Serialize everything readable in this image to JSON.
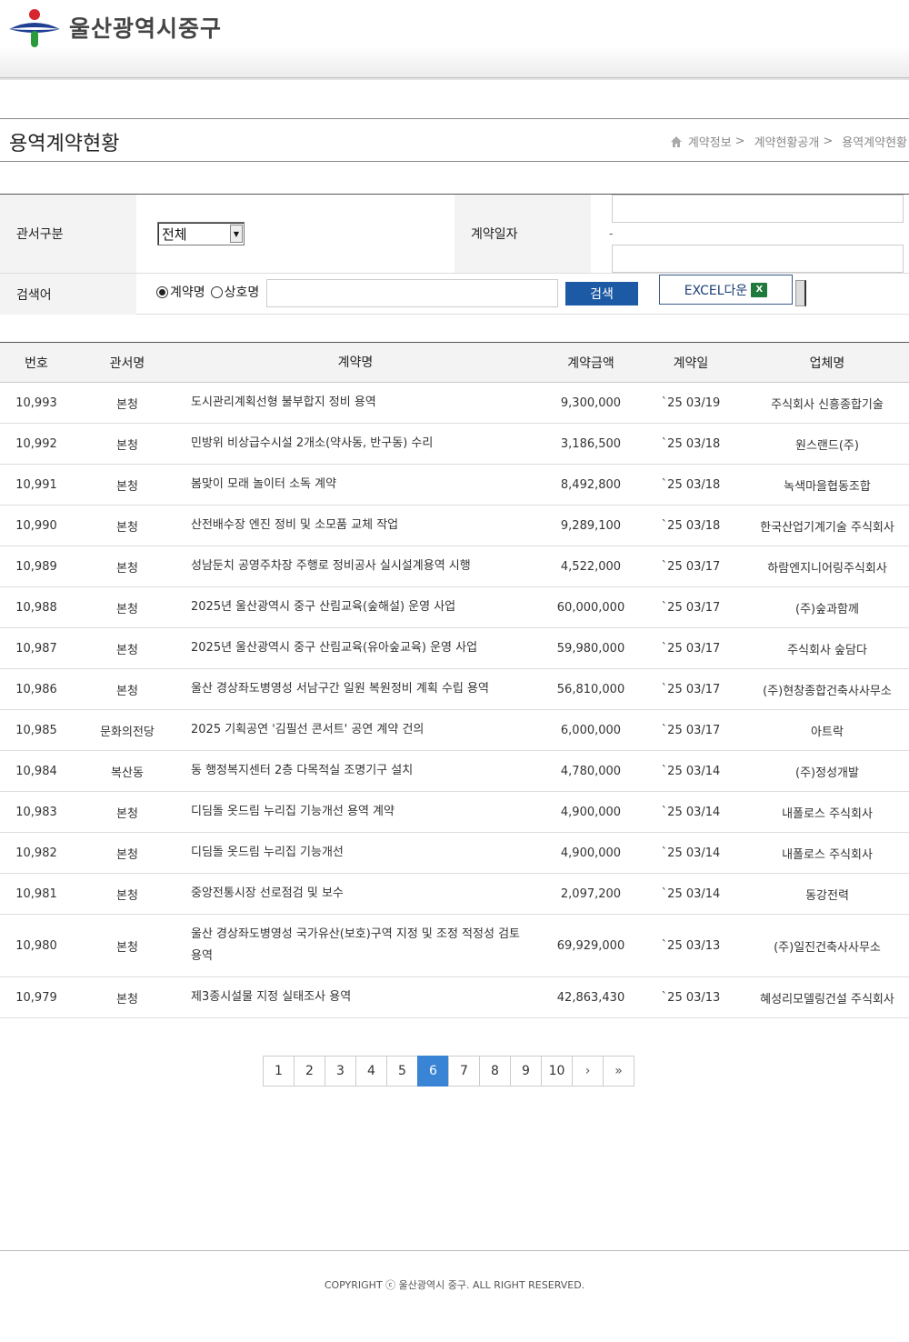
{
  "header": {
    "org_name": "울산광역시중구"
  },
  "page": {
    "title": "용역계약현황",
    "breadcrumb": [
      "계약정보",
      "계약현황공개",
      "용역계약현황"
    ],
    "breadcrumb_sep": ">"
  },
  "search": {
    "dept_label": "관서구분",
    "dept_value": "전체",
    "date_label": "계약일자",
    "date_sep": "-",
    "keyword_label": "검색어",
    "radio_contract": "계약명",
    "radio_company": "상호명",
    "search_button": "검색",
    "excel_button": "EXCEL다운",
    "excel_icon_text": "X"
  },
  "table": {
    "headers": [
      "번호",
      "관서명",
      "계약명",
      "계약금액",
      "계약일",
      "업체명"
    ],
    "rows": [
      [
        "10,993",
        "본청",
        "도시관리계획선형 불부합지 정비 용역",
        "9,300,000",
        "`25 03/19",
        "주식회사 신흥종합기술"
      ],
      [
        "10,992",
        "본청",
        "민방위 비상급수시설 2개소(약사동, 반구동) 수리",
        "3,186,500",
        "`25 03/18",
        "원스랜드(주)"
      ],
      [
        "10,991",
        "본청",
        "봄맞이 모래 놀이터 소독 계약",
        "8,492,800",
        "`25 03/18",
        "녹색마을협동조합"
      ],
      [
        "10,990",
        "본청",
        "산전배수장 엔진 정비 및 소모품 교체 작업",
        "9,289,100",
        "`25 03/18",
        "한국산업기계기술 주식회사"
      ],
      [
        "10,989",
        "본청",
        "성남둔치 공영주차장 주행로 정비공사 실시설계용역 시행",
        "4,522,000",
        "`25 03/17",
        "하람엔지니어링주식회사"
      ],
      [
        "10,988",
        "본청",
        "2025년 울산광역시 중구 산림교육(숲해설) 운영 사업",
        "60,000,000",
        "`25 03/17",
        "(주)숲과함께"
      ],
      [
        "10,987",
        "본청",
        "2025년 울산광역시 중구 산림교육(유아숲교육) 운영 사업",
        "59,980,000",
        "`25 03/17",
        "주식회사 숲담다"
      ],
      [
        "10,986",
        "본청",
        "울산 경상좌도병영성 서남구간 일원 복원정비 계획 수립 용역",
        "56,810,000",
        "`25 03/17",
        "(주)현창종합건축사사무소"
      ],
      [
        "10,985",
        "문화의전당",
        "2025 기획공연 '김필선 콘서트' 공연 계약 건의",
        "6,000,000",
        "`25 03/17",
        "아트락"
      ],
      [
        "10,984",
        "복산동",
        "동 행정복지센터 2층 다목적실 조명기구 설치",
        "4,780,000",
        "`25 03/14",
        "(주)정성개발"
      ],
      [
        "10,983",
        "본청",
        "디딤돌 옷드림 누리집 기능개선 용역 계약",
        "4,900,000",
        "`25 03/14",
        "내폴로스 주식회사"
      ],
      [
        "10,982",
        "본청",
        "디딤돌 옷드림 누리집 기능개선",
        "4,900,000",
        "`25 03/14",
        "내폴로스 주식회사"
      ],
      [
        "10,981",
        "본청",
        "중앙전통시장 선로점검 및 보수",
        "2,097,200",
        "`25 03/14",
        "동강전력"
      ],
      [
        "10,980",
        "본청",
        "울산 경상좌도병영성 국가유산(보호)구역 지정 및 조정 적정성 검토 용역",
        "69,929,000",
        "`25 03/13",
        "(주)일진건축사사무소"
      ],
      [
        "10,979",
        "본청",
        "제3종시설물 지정 실태조사 용역",
        "42,863,430",
        "`25 03/13",
        "혜성리모델링건설 주식회사"
      ]
    ]
  },
  "pagination": {
    "pages": [
      "1",
      "2",
      "3",
      "4",
      "5",
      "6",
      "7",
      "8",
      "9",
      "10"
    ],
    "current": "6",
    "next": "›",
    "last": "»"
  },
  "footer": {
    "copyright": "COPYRIGHT ⓒ 울산광역시 중구. ALL RIGHT RESERVED."
  },
  "colors": {
    "search_button": "#1d5aa6",
    "active_page": "#3a84d6",
    "excel_icon": "#1f7a3c"
  }
}
